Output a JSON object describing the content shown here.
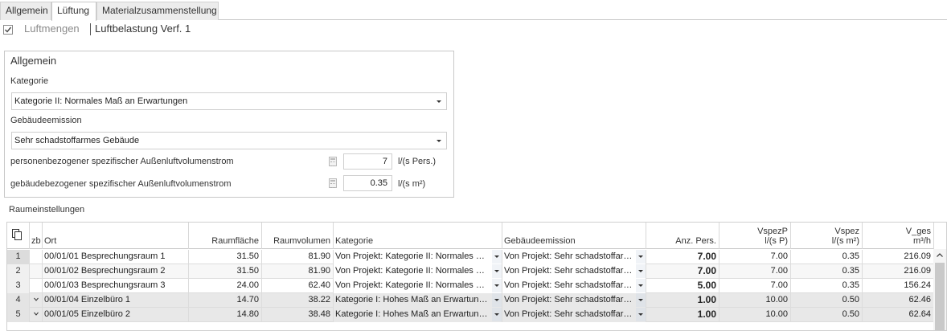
{
  "tabs": [
    "Allgemein",
    "Lüftung",
    "Materialzusammenstellung"
  ],
  "active_tab": 1,
  "subheader": {
    "checkbox_checked": true,
    "crumb1": "Luftmengen",
    "crumb2": "Luftbelastung Verf. 1"
  },
  "group": {
    "title": "Allgemein",
    "kategorie_label": "Kategorie",
    "kategorie_value": "Kategorie II: Normales Maß an Erwartungen",
    "emission_label": "Gebäudeemission",
    "emission_value": "Sehr schadstoffarmes Gebäude",
    "person_label": "personenbezogener spezifischer Außenluftvolumenstrom",
    "person_value": "7",
    "person_unit": "l/(s Pers.)",
    "building_label": "gebäudebezogener spezifischer Außenluftvolumenstrom",
    "building_value": "0.35",
    "building_unit": "l/(s m²)"
  },
  "section_label": "Raumeinstellungen",
  "grid": {
    "headers": {
      "zb": "zb",
      "ort": "Ort",
      "raumflaeche": "Raumfläche",
      "raumvolumen": "Raumvolumen",
      "kategorie": "Kategorie",
      "emission": "Gebäudeemission",
      "anz": "Anz. Pers.",
      "vspezp1": "VspezP",
      "vspezp2": "l/(s P)",
      "vspez1": "Vspez",
      "vspez2": "l/(s m²)",
      "vges1": "V_ges",
      "vges2": "m³/h"
    },
    "rows": [
      {
        "num": "1",
        "zb": "",
        "ort": "00/01/01 Besprechungsraum 1",
        "flaeche": "31.50",
        "volumen": "81.90",
        "kategorie": "Von Projekt: Kategorie II: Normales Maß an Erwartungen",
        "emission": "Von Projekt: Sehr schadstoffarmes Gebäude",
        "anz": "7.00",
        "vspezp": "7.00",
        "vspez": "0.35",
        "vges": "216.09"
      },
      {
        "num": "2",
        "zb": "",
        "ort": "00/01/02 Besprechungsraum 2",
        "flaeche": "31.50",
        "volumen": "81.90",
        "kategorie": "Von Projekt: Kategorie II: Normales Maß an Erwartungen",
        "emission": "Von Projekt: Sehr schadstoffarmes Gebäude",
        "anz": "7.00",
        "vspezp": "7.00",
        "vspez": "0.35",
        "vges": "216.09"
      },
      {
        "num": "3",
        "zb": "",
        "ort": "00/01/03 Besprechungsraum 3",
        "flaeche": "24.00",
        "volumen": "62.40",
        "kategorie": "Von Projekt: Kategorie II: Normales Maß an Erwartungen",
        "emission": "Von Projekt: Sehr schadstoffarmes Gebäude",
        "anz": "5.00",
        "vspezp": "7.00",
        "vspez": "0.35",
        "vges": "156.24"
      },
      {
        "num": "4",
        "zb": "",
        "ort": "00/01/04 Einzelbüro 1",
        "flaeche": "14.70",
        "volumen": "38.22",
        "kategorie": "Kategorie I: Hohes Maß an Erwartungen",
        "emission": "Von Projekt: Sehr schadstoffarmes Gebäude",
        "anz": "1.00",
        "vspezp": "10.00",
        "vspez": "0.50",
        "vges": "62.46"
      },
      {
        "num": "5",
        "zb": "",
        "ort": "00/01/05 Einzelbüro 2",
        "flaeche": "14.80",
        "volumen": "38.48",
        "kategorie": "Kategorie I: Hohes Maß an Erwartungen",
        "emission": "Von Projekt: Sehr schadstoffarmes Gebäude",
        "anz": "1.00",
        "vspezp": "10.00",
        "vspez": "0.50",
        "vges": "62.64"
      }
    ]
  }
}
